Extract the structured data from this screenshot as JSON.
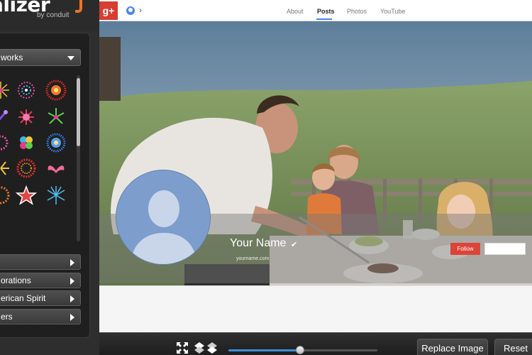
{
  "brand": {
    "logo_text": "alizer",
    "byline": "by conduit"
  },
  "sidebar": {
    "category": "works",
    "firework_icons": [
      "firework-burst-icon",
      "firework-ring-icon",
      "firework-red-burst-icon",
      "firework-purple-icon",
      "firework-spark-icon",
      "firework-green-icon",
      "firework-pink-icon",
      "firework-multicolor-icon",
      "firework-blue-icon",
      "firework-gold-icon",
      "firework-red-ring-icon",
      "firework-wings-icon",
      "firework-orange-icon",
      "star-icon",
      "firework-blue-burst-icon"
    ],
    "sections": [
      {
        "label": ""
      },
      {
        "label": "orations"
      },
      {
        "label": "erican Spirit"
      },
      {
        "label": "ers"
      }
    ]
  },
  "gplus": {
    "logo": "g+",
    "tabs": [
      {
        "label": "About",
        "active": false
      },
      {
        "label": "Posts",
        "active": true
      },
      {
        "label": "Photos",
        "active": false
      },
      {
        "label": "YouTube",
        "active": false
      }
    ],
    "profile_name": "Your Name",
    "profile_handle": "yourname.com",
    "follow_label": "Follow"
  },
  "toolbar": {
    "zoom_level": 0.48,
    "replace_label": "Replace Image",
    "reset_label": "Reset"
  },
  "colors": {
    "gplus_red": "#db4437",
    "accent_orange": "#e8742a",
    "slider_blue": "#3b8ed8"
  }
}
